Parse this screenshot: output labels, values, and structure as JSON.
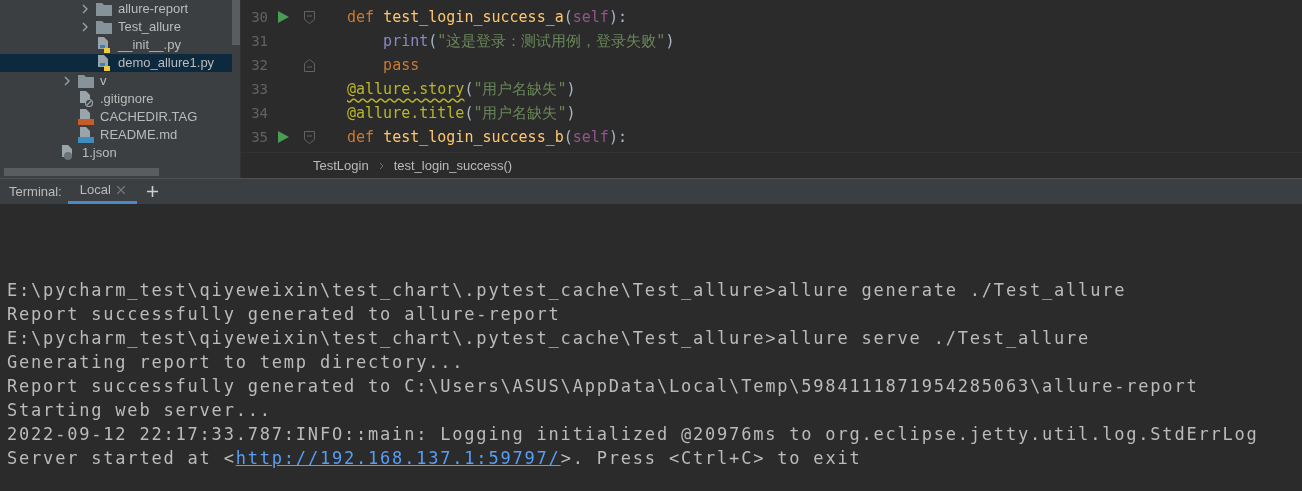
{
  "project_tree": [
    {
      "children": [
        {
          "children": [
            {
              "label": "allure-report",
              "kind": "folder",
              "expanded": false,
              "selected": false
            },
            {
              "label": "Test_allure",
              "kind": "folder",
              "expanded": false,
              "selected": false
            },
            {
              "label": "__init__.py",
              "kind": "python",
              "selected": false
            },
            {
              "label": "demo_allure1.py",
              "kind": "python",
              "selected": true
            }
          ]
        },
        {
          "label": "v",
          "kind": "folder",
          "expanded": false,
          "selected": false
        },
        {
          "label": ".gitignore",
          "kind": "ignore",
          "selected": false
        },
        {
          "label": "CACHEDIR.TAG",
          "kind": "jsp",
          "selected": false
        },
        {
          "label": "README.md",
          "kind": "markdown",
          "selected": false
        }
      ]
    },
    {
      "label": "1.json",
      "kind": "json",
      "selected": false
    }
  ],
  "editor": {
    "lines": [
      {
        "number": "30",
        "run": true,
        "fold_start": true,
        "fold_end": false,
        "tokens": [
          {
            "kind": "keyword",
            "text": "def "
          },
          {
            "kind": "func",
            "text": "test_login_success_a"
          },
          {
            "kind": "plain",
            "text": "("
          },
          {
            "kind": "self",
            "text": "self"
          },
          {
            "kind": "plain",
            "text": "):"
          }
        ]
      },
      {
        "number": "31",
        "run": false,
        "fold_start": false,
        "fold_end": false,
        "tokens": [
          {
            "kind": "builtin",
            "text": "    print"
          },
          {
            "kind": "plain",
            "text": "("
          },
          {
            "kind": "string",
            "text": "\"这是登录：测试用例，登录失败\""
          },
          {
            "kind": "plain",
            "text": ")"
          }
        ]
      },
      {
        "number": "32",
        "run": false,
        "fold_start": false,
        "fold_end": true,
        "tokens": [
          {
            "kind": "keyword",
            "text": "    pass"
          }
        ]
      },
      {
        "number": "33",
        "run": false,
        "fold_start": false,
        "fold_end": false,
        "tokens": [
          {
            "kind": "decorator",
            "text": "@allure.story",
            "warning": true
          },
          {
            "kind": "plain",
            "text": "("
          },
          {
            "kind": "string",
            "text": "\"用户名缺失\""
          },
          {
            "kind": "plain",
            "text": ")"
          }
        ]
      },
      {
        "number": "34",
        "run": false,
        "fold_start": false,
        "fold_end": false,
        "tokens": [
          {
            "kind": "decorator",
            "text": "@allure.title",
            "warning": false
          },
          {
            "kind": "plain",
            "text": "("
          },
          {
            "kind": "string",
            "text": "\"用户名缺失\""
          },
          {
            "kind": "plain",
            "text": ")"
          }
        ]
      },
      {
        "number": "35",
        "run": true,
        "fold_start": true,
        "fold_end": false,
        "tokens": [
          {
            "kind": "keyword",
            "text": "def "
          },
          {
            "kind": "func",
            "text": "test_login_success_b"
          },
          {
            "kind": "plain",
            "text": "("
          },
          {
            "kind": "self",
            "text": "self"
          },
          {
            "kind": "plain",
            "text": "):"
          }
        ]
      }
    ],
    "breadcrumb": [
      "TestLogin",
      "test_login_success()"
    ]
  },
  "terminal": {
    "label": "Terminal:",
    "tabs": [
      {
        "label": "Local",
        "selected": true
      }
    ],
    "lines": [
      [
        {
          "kind": "text",
          "text": "E:\\pycharm_test\\qiyeweixin\\test_chart\\.pytest_cache\\Test_allure>allure generate ./Test_allure"
        }
      ],
      [
        {
          "kind": "text",
          "text": "Report successfully generated to allure-report"
        }
      ],
      [
        {
          "kind": "text",
          "text": "E:\\pycharm_test\\qiyeweixin\\test_chart\\.pytest_cache\\Test_allure>allure serve ./Test_allure"
        }
      ],
      [
        {
          "kind": "text",
          "text": "Generating report to temp directory..."
        }
      ],
      [
        {
          "kind": "text",
          "text": "Report successfully generated to C:\\Users\\ASUS\\AppData\\Local\\Temp\\5984111871954285063\\allure-report"
        }
      ],
      [
        {
          "kind": "text",
          "text": "Starting web server..."
        }
      ],
      [
        {
          "kind": "text",
          "text": "2022-09-12 22:17:33.787:INFO::main: Logging initialized @20976ms to org.eclipse.jetty.util.log.StdErrLog"
        }
      ],
      [
        {
          "kind": "text",
          "text": "Server started at <"
        },
        {
          "kind": "link",
          "text": "http://192.168.137.1:59797/"
        },
        {
          "kind": "text",
          "text": ">. Press <Ctrl+C> to exit"
        }
      ]
    ]
  }
}
